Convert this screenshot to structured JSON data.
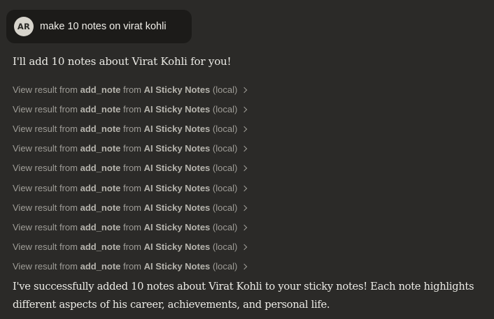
{
  "user_message": {
    "avatar_initials": "AR",
    "text": "make 10 notes on virat kohli"
  },
  "assistant": {
    "intro": "I'll add 10 notes about Virat Kohli for you!",
    "tool_results": [
      {
        "prefix": "View result from",
        "tool": "add_note",
        "mid": "from",
        "server": "AI Sticky Notes",
        "suffix": "(local)"
      },
      {
        "prefix": "View result from",
        "tool": "add_note",
        "mid": "from",
        "server": "AI Sticky Notes",
        "suffix": "(local)"
      },
      {
        "prefix": "View result from",
        "tool": "add_note",
        "mid": "from",
        "server": "AI Sticky Notes",
        "suffix": "(local)"
      },
      {
        "prefix": "View result from",
        "tool": "add_note",
        "mid": "from",
        "server": "AI Sticky Notes",
        "suffix": "(local)"
      },
      {
        "prefix": "View result from",
        "tool": "add_note",
        "mid": "from",
        "server": "AI Sticky Notes",
        "suffix": "(local)"
      },
      {
        "prefix": "View result from",
        "tool": "add_note",
        "mid": "from",
        "server": "AI Sticky Notes",
        "suffix": "(local)"
      },
      {
        "prefix": "View result from",
        "tool": "add_note",
        "mid": "from",
        "server": "AI Sticky Notes",
        "suffix": "(local)"
      },
      {
        "prefix": "View result from",
        "tool": "add_note",
        "mid": "from",
        "server": "AI Sticky Notes",
        "suffix": "(local)"
      },
      {
        "prefix": "View result from",
        "tool": "add_note",
        "mid": "from",
        "server": "AI Sticky Notes",
        "suffix": "(local)"
      },
      {
        "prefix": "View result from",
        "tool": "add_note",
        "mid": "from",
        "server": "AI Sticky Notes",
        "suffix": "(local)"
      }
    ],
    "final_message": "I've successfully added 10 notes about Virat Kohli to your sticky notes! Each note highlights different aspects of his career, achievements, and personal life."
  },
  "icons": {
    "result_expand": "chevron-right-icon"
  },
  "colors": {
    "background": "#2b2a28",
    "user_bubble": "#1c1b19",
    "avatar": "#d7d4cc",
    "text_primary": "#ecebe6",
    "text_muted": "#9f9d97"
  }
}
